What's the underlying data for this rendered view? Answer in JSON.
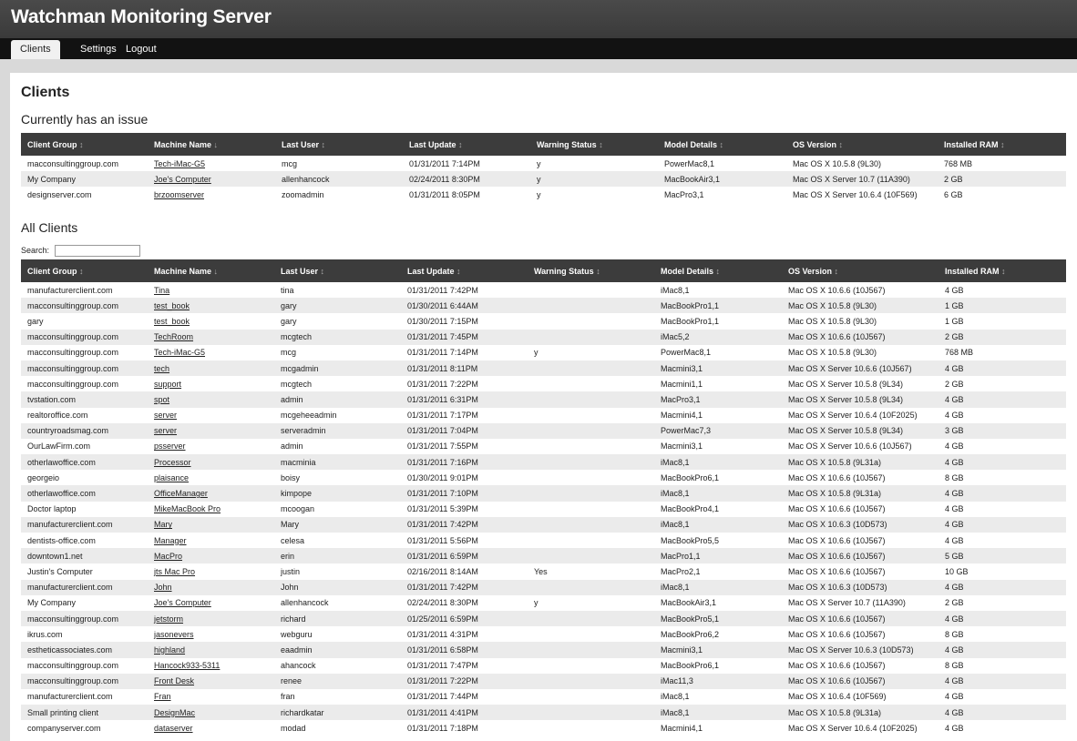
{
  "app": {
    "title": "Watchman Monitoring Server"
  },
  "nav": {
    "tabs": [
      "Clients",
      "Settings",
      "Logout"
    ]
  },
  "page": {
    "title": "Clients",
    "issue_section": "Currently has an issue",
    "all_section": "All Clients",
    "search_label": "Search:",
    "search_value": ""
  },
  "columns": [
    {
      "label": "Client Group",
      "sort": "↕"
    },
    {
      "label": "Machine Name",
      "sort": "↓"
    },
    {
      "label": "Last User",
      "sort": "↕"
    },
    {
      "label": "Last Update",
      "sort": "↕"
    },
    {
      "label": "Warning Status",
      "sort": "↕"
    },
    {
      "label": "Model Details",
      "sort": "↕"
    },
    {
      "label": "OS Version",
      "sort": "↕"
    },
    {
      "label": "Installed RAM",
      "sort": "↕"
    }
  ],
  "issue_rows": [
    [
      "macconsultinggroup.com",
      "Tech-iMac-G5",
      "mcg",
      "01/31/2011 7:14PM",
      "y",
      "PowerMac8,1",
      "Mac OS X 10.5.8 (9L30)",
      "768 MB"
    ],
    [
      "My Company",
      "Joe's Computer",
      "allenhancock",
      "02/24/2011 8:30PM",
      "y",
      "MacBookAir3,1",
      "Mac OS X Server 10.7 (11A390)",
      "2 GB"
    ],
    [
      "designserver.com",
      "brzoomserver",
      "zoomadmin",
      "01/31/2011 8:05PM",
      "y",
      "MacPro3,1",
      "Mac OS X Server 10.6.4 (10F569)",
      "6 GB"
    ]
  ],
  "all_rows": [
    [
      "manufacturerclient.com",
      "Tina",
      "tina",
      "01/31/2011 7:42PM",
      "",
      "iMac8,1",
      "Mac OS X 10.6.6 (10J567)",
      "4 GB"
    ],
    [
      "macconsultinggroup.com",
      "test_book",
      "gary",
      "01/30/2011 6:44AM",
      "",
      "MacBookPro1,1",
      "Mac OS X 10.5.8 (9L30)",
      "1 GB"
    ],
    [
      "gary",
      "test_book",
      "gary",
      "01/30/2011 7:15PM",
      "",
      "MacBookPro1,1",
      "Mac OS X 10.5.8 (9L30)",
      "1 GB"
    ],
    [
      "macconsultinggroup.com",
      "TechRoom",
      "mcgtech",
      "01/31/2011 7:45PM",
      "",
      "iMac5,2",
      "Mac OS X 10.6.6 (10J567)",
      "2 GB"
    ],
    [
      "macconsultinggroup.com",
      "Tech-iMac-G5",
      "mcg",
      "01/31/2011 7:14PM",
      "y",
      "PowerMac8,1",
      "Mac OS X 10.5.8 (9L30)",
      "768 MB"
    ],
    [
      "macconsultinggroup.com",
      "tech",
      "mcgadmin",
      "01/31/2011 8:11PM",
      "",
      "Macmini3,1",
      "Mac OS X Server 10.6.6 (10J567)",
      "4 GB"
    ],
    [
      "macconsultinggroup.com",
      "support",
      "mcgtech",
      "01/31/2011 7:22PM",
      "",
      "Macmini1,1",
      "Mac OS X Server 10.5.8 (9L34)",
      "2 GB"
    ],
    [
      "tvstation.com",
      "spot",
      "admin",
      "01/31/2011 6:31PM",
      "",
      "MacPro3,1",
      "Mac OS X Server 10.5.8 (9L34)",
      "4 GB"
    ],
    [
      "realtoroffice.com",
      "server",
      "mcgeheeadmin",
      "01/31/2011 7:17PM",
      "",
      "Macmini4,1",
      "Mac OS X Server 10.6.4 (10F2025)",
      "4 GB"
    ],
    [
      "countryroadsmag.com",
      "server",
      "serveradmin",
      "01/31/2011 7:04PM",
      "",
      "PowerMac7,3",
      "Mac OS X Server 10.5.8 (9L34)",
      "3 GB"
    ],
    [
      "OurLawFirm.com",
      "psserver",
      "admin",
      "01/31/2011 7:55PM",
      "",
      "Macmini3,1",
      "Mac OS X Server 10.6.6 (10J567)",
      "4 GB"
    ],
    [
      "otherlawoffice.com",
      "Processor",
      "macminia",
      "01/31/2011 7:16PM",
      "",
      "iMac8,1",
      "Mac OS X 10.5.8 (9L31a)",
      "4 GB"
    ],
    [
      "georgeio",
      "plaisance",
      "boisy",
      "01/30/2011 9:01PM",
      "",
      "MacBookPro6,1",
      "Mac OS X 10.6.6 (10J567)",
      "8 GB"
    ],
    [
      "otherlawoffice.com",
      "OfficeManager",
      "kimpope",
      "01/31/2011 7:10PM",
      "",
      "iMac8,1",
      "Mac OS X 10.5.8 (9L31a)",
      "4 GB"
    ],
    [
      "Doctor laptop",
      "MikeMacBook Pro",
      "mcoogan",
      "01/31/2011 5:39PM",
      "",
      "MacBookPro4,1",
      "Mac OS X 10.6.6 (10J567)",
      "4 GB"
    ],
    [
      "manufacturerclient.com",
      "Mary",
      "Mary",
      "01/31/2011 7:42PM",
      "",
      "iMac8,1",
      "Mac OS X 10.6.3 (10D573)",
      "4 GB"
    ],
    [
      "dentists-office.com",
      "Manager",
      "celesa",
      "01/31/2011 5:56PM",
      "",
      "MacBookPro5,5",
      "Mac OS X 10.6.6 (10J567)",
      "4 GB"
    ],
    [
      "downtown1.net",
      "MacPro",
      "erin",
      "01/31/2011 6:59PM",
      "",
      "MacPro1,1",
      "Mac OS X 10.6.6 (10J567)",
      "5 GB"
    ],
    [
      "Justin's Computer",
      "jts Mac Pro",
      "justin",
      "02/16/2011 8:14AM",
      "Yes",
      "MacPro2,1",
      "Mac OS X 10.6.6 (10J567)",
      "10 GB"
    ],
    [
      "manufacturerclient.com",
      "John",
      "John",
      "01/31/2011 7:42PM",
      "",
      "iMac8,1",
      "Mac OS X 10.6.3 (10D573)",
      "4 GB"
    ],
    [
      "My Company",
      "Joe's Computer",
      "allenhancock",
      "02/24/2011 8:30PM",
      "y",
      "MacBookAir3,1",
      "Mac OS X Server 10.7 (11A390)",
      "2 GB"
    ],
    [
      "macconsultinggroup.com",
      "jetstorm",
      "richard",
      "01/25/2011 6:59PM",
      "",
      "MacBookPro5,1",
      "Mac OS X 10.6.6 (10J567)",
      "4 GB"
    ],
    [
      "ikrus.com",
      "jasonevers",
      "webguru",
      "01/31/2011 4:31PM",
      "",
      "MacBookPro6,2",
      "Mac OS X 10.6.6 (10J567)",
      "8 GB"
    ],
    [
      "estheticassociates.com",
      "highland",
      "eaadmin",
      "01/31/2011 6:58PM",
      "",
      "Macmini3,1",
      "Mac OS X Server 10.6.3 (10D573)",
      "4 GB"
    ],
    [
      "macconsultinggroup.com",
      "Hancock933-5311",
      "ahancock",
      "01/31/2011 7:47PM",
      "",
      "MacBookPro6,1",
      "Mac OS X 10.6.6 (10J567)",
      "8 GB"
    ],
    [
      "macconsultinggroup.com",
      "Front Desk",
      "renee",
      "01/31/2011 7:22PM",
      "",
      "iMac11,3",
      "Mac OS X 10.6.6 (10J567)",
      "4 GB"
    ],
    [
      "manufacturerclient.com",
      "Fran",
      "fran",
      "01/31/2011 7:44PM",
      "",
      "iMac8,1",
      "Mac OS X 10.6.4 (10F569)",
      "4 GB"
    ],
    [
      "Small printing client",
      "DesignMac",
      "richardkatar",
      "01/31/2011 4:41PM",
      "",
      "iMac8,1",
      "Mac OS X 10.5.8 (9L31a)",
      "4 GB"
    ],
    [
      "companyserver.com",
      "dataserver",
      "modad",
      "01/31/2011 7:18PM",
      "",
      "Macmini4,1",
      "Mac OS X Server 10.6.4 (10F2025)",
      "4 GB"
    ]
  ]
}
